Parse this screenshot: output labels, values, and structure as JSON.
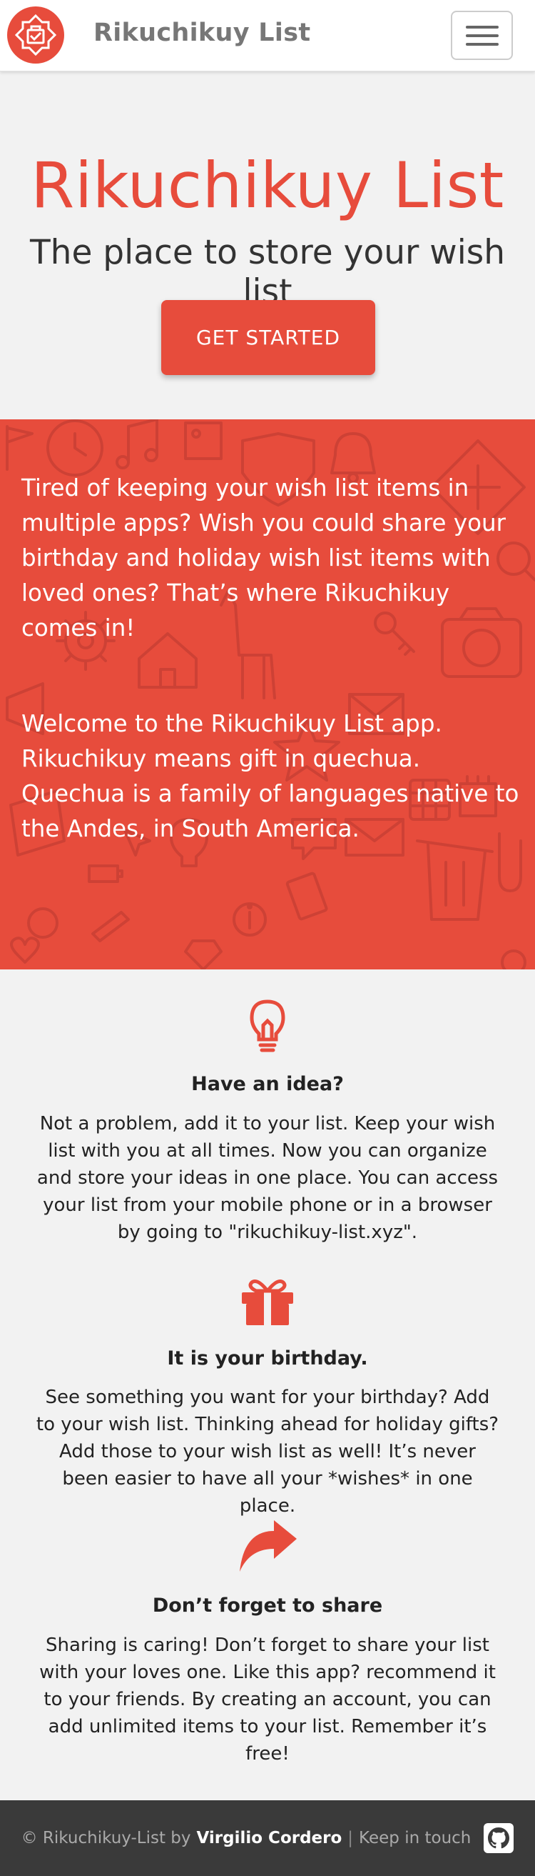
{
  "navbar": {
    "brand": "Rikuchikuy List",
    "logo_icon": "gift-logo-icon",
    "menu_icon": "hamburger-menu-icon"
  },
  "hero": {
    "title": "Rikuchikuy List",
    "subtitle": "The place to store your wish list",
    "cta_label": "GET STARTED"
  },
  "band": {
    "paragraph1": "Tired of keeping your wish list items in multiple apps? Wish you could share your birthday and holiday wish list items with loved ones? That’s where Rikuchikuy comes in!",
    "paragraph2": "Welcome to the Rikuchikuy List app. Rikuchikuy means gift in quechua. Quechua is a family of languages native to the Andes, in South America."
  },
  "features": [
    {
      "icon": "lightbulb-icon",
      "title": "Have an idea?",
      "text": "Not a problem, add it to your list. Keep your wish list with you at all times. Now you can organize and store your ideas in one place. You can access your list from your mobile phone or in a browser by going to \"rikuchikuy-list.xyz\"."
    },
    {
      "icon": "gift-icon",
      "title": "It is your birthday.",
      "text": "See something you want for your birthday? Add to your wish list. Thinking ahead for holiday gifts? Add those to your wish list as well! It’s never been easier to have all your *wishes* in one place."
    },
    {
      "icon": "share-arrow-icon",
      "title": "Don’t forget to share",
      "text": "Sharing is caring! Don’t forget to share your list with your loves one. Like this app? recommend it to your friends. By creating an account, you can add unlimited items to your list. Remember it’s free!"
    }
  ],
  "footer": {
    "copyright": "© Rikuchikuy-List by",
    "author": "Virgilio Cordero",
    "separator": "|",
    "keep_in_touch": "Keep in touch",
    "github_icon": "github-icon"
  },
  "colors": {
    "accent": "#e74c3c",
    "footer_bg": "#3a3a3a",
    "page_bg": "#f2f2f2"
  }
}
